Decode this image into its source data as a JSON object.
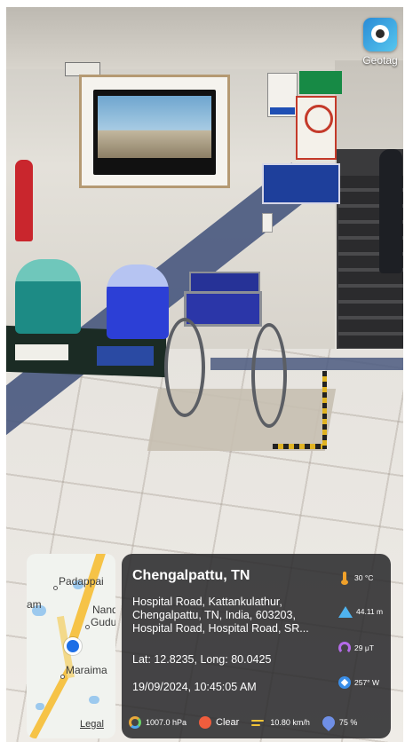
{
  "app": {
    "name": "Geotag",
    "icon": "camera-lens-icon",
    "accent_color": "#2a8bd6"
  },
  "map": {
    "labels": {
      "padappai": "Padappai",
      "am": "am",
      "nand": "Nand",
      "gudu": "Gudu",
      "maraima": "Maraima"
    },
    "legal": "Legal",
    "pin_icon": "location-pin-icon"
  },
  "info": {
    "title": "Chengalpattu, TN",
    "address": "Hospital Road, Kattankulathur, Chengalpattu, TN, India, 603203, Hospital Road, Hospital Road, SR...",
    "latlong": "Lat: 12.8235, Long: 80.0425",
    "datetime": "19/09/2024, 10:45:05 AM",
    "side_stats": {
      "temperature": {
        "icon": "thermometer-icon",
        "value": "30 °C"
      },
      "altitude": {
        "icon": "mountain-icon",
        "value": "44.11 m"
      },
      "magnetic": {
        "icon": "magnet-icon",
        "value": "29 μT"
      },
      "direction": {
        "icon": "compass-icon",
        "value": "257° W"
      }
    },
    "bottom_stats": {
      "pressure": {
        "icon": "gauge-icon",
        "value": "1007.0 hPa"
      },
      "weather": {
        "icon": "sun-icon",
        "value": "Clear"
      },
      "wind": {
        "icon": "wind-icon",
        "value": "10.80 km/h"
      },
      "humidity": {
        "icon": "humidity-icon",
        "value": "75 %"
      }
    }
  },
  "colors": {
    "panel_bg": "#28282a",
    "pin": "#1e6fe6",
    "road": "#f6c347"
  }
}
